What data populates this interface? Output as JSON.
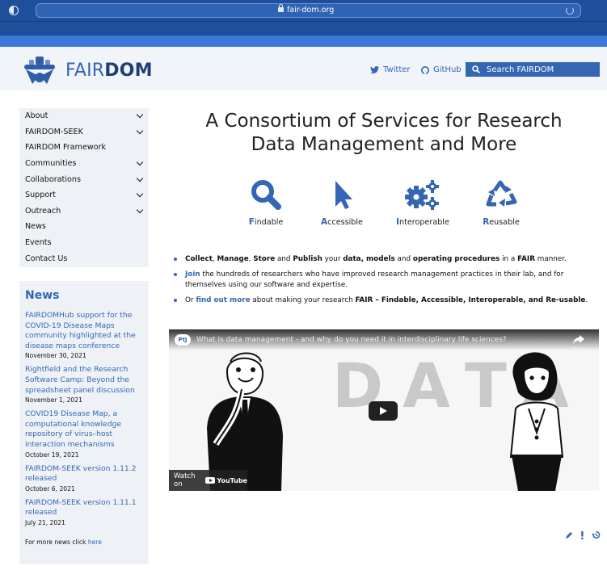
{
  "browser": {
    "url": "fair-dom.org",
    "icons": [
      "sidebar-toggle-icon",
      "lock-icon",
      "reload-icon"
    ]
  },
  "header": {
    "brand_fair": "FAIR",
    "brand_dom": "DOM",
    "twitter": "Twitter",
    "github": "GitHub",
    "search_placeholder": "Search FAIRDOM"
  },
  "sidebar": {
    "items": [
      {
        "label": "About",
        "expandable": true
      },
      {
        "label": "FAIRDOM-SEEK",
        "expandable": true
      },
      {
        "label": "FAIRDOM Framework",
        "expandable": false
      },
      {
        "label": "Communities",
        "expandable": true
      },
      {
        "label": "Collaborations",
        "expandable": true
      },
      {
        "label": "Support",
        "expandable": true
      },
      {
        "label": "Outreach",
        "expandable": true
      },
      {
        "label": "News",
        "expandable": false
      },
      {
        "label": "Events",
        "expandable": false
      },
      {
        "label": "Contact Us",
        "expandable": false
      }
    ]
  },
  "news": {
    "title": "News",
    "items": [
      {
        "title": "FAIRDOMHub support for the COVID-19 Disease Maps community highlighted at the disease maps conference",
        "date": "November 30, 2021"
      },
      {
        "title": "Rightfield and the Research Software Camp: Beyond the spreadsheet panel discussion",
        "date": "November 1, 2021"
      },
      {
        "title": "COVID19 Disease Map, a computational knowledge repository of virus–host interaction mechanisms",
        "date": "October 19, 2021"
      },
      {
        "title": "FAIRDOM-SEEK version 1.11.2 released",
        "date": "October 6, 2021"
      },
      {
        "title": "FAIRDOM-SEEK version 1.11.1 released",
        "date": "July 21, 2021"
      }
    ],
    "more_text": "For more news click ",
    "more_link": "here"
  },
  "main": {
    "headline_line1": "A Consortium of Services for Research",
    "headline_line2": "Data Management and More",
    "fair": [
      {
        "initial": "F",
        "rest": "indable",
        "icon": "magnifier-icon"
      },
      {
        "initial": "A",
        "rest": "ccessible",
        "icon": "pointer-icon"
      },
      {
        "initial": "I",
        "rest": "nteroperable",
        "icon": "gears-icon"
      },
      {
        "initial": "R",
        "rest": "eusable",
        "icon": "recycle-icon"
      }
    ],
    "bullets": {
      "b1": {
        "w1": "Collect",
        "s1": ", ",
        "w2": "Manage",
        "s2": ", ",
        "w3": "Store",
        "s3": " and ",
        "w4": "Publish",
        "s4": " your ",
        "w5": "data, models",
        "s5": " and ",
        "w6": "operating procedures",
        "s6": " in a ",
        "w7": "FAIR",
        "s7": " manner."
      },
      "b2": {
        "link": "Join",
        "text": " the hundreds of researchers who have improved research management practices in their lab, and for themselves using our software and expertise."
      },
      "b3": {
        "pre": "Or ",
        "link": "find out more",
        "mid": " about making your research ",
        "bold": "FAIR – Findable, Accessible, Interoperable, and Re-usable",
        "end": "."
      }
    },
    "video": {
      "channel": "PtJ",
      "title": "What is data management - and why do you need it in interdisciplinary life sciences?",
      "big_text": "DATA",
      "share": "Share",
      "watch_on": "Watch on",
      "youtube": "YouTube"
    }
  },
  "footer_tools": [
    "pencil-icon",
    "exclamation-icon",
    "history-icon"
  ],
  "colors": {
    "accent": "#3466b4",
    "chrome": "#1f4f9a",
    "panel": "#eef2f7"
  }
}
